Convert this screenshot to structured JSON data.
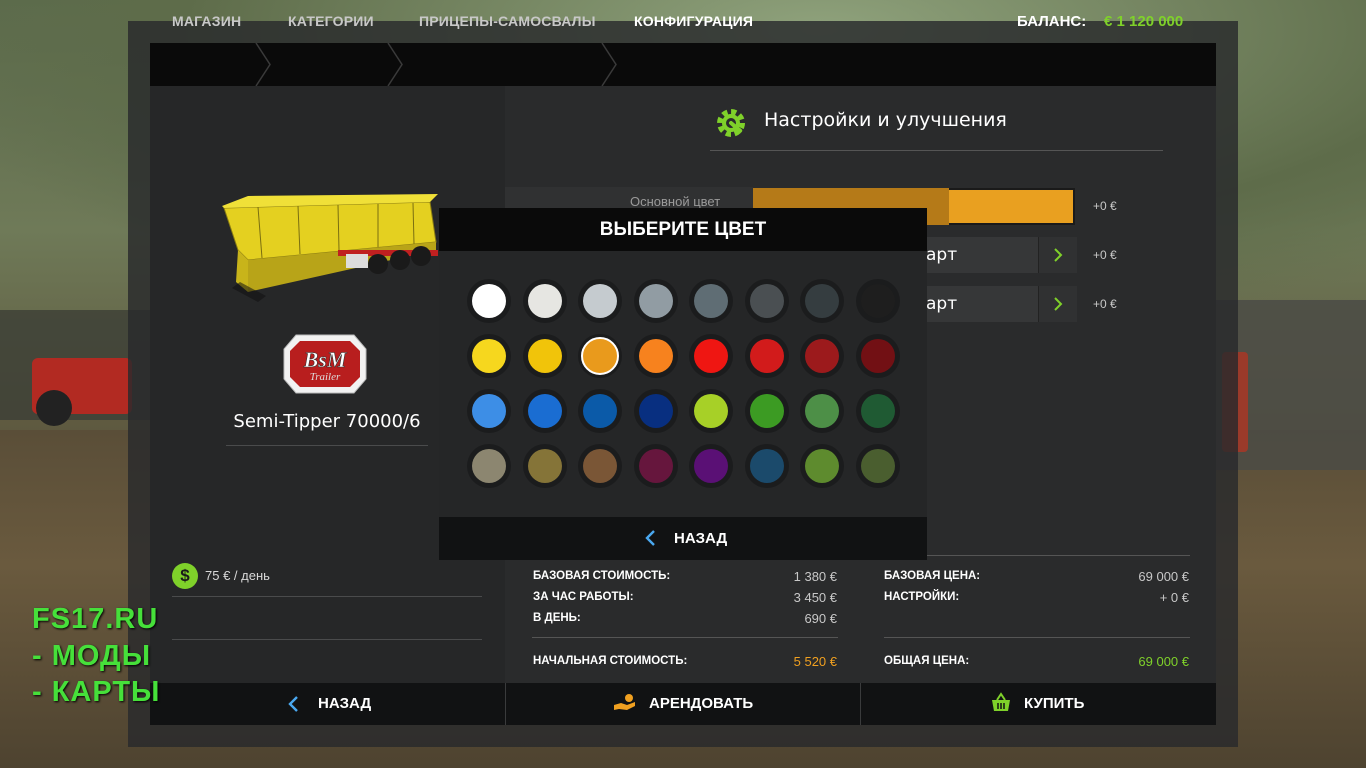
{
  "breadcrumbs": [
    "МАГАЗИН",
    "КАТЕГОРИИ",
    "ПРИЦЕПЫ-САМОСВАЛЫ",
    "КОНФИГУРАЦИЯ"
  ],
  "balance": {
    "label": "БАЛАНС:",
    "value": "€ 1 120 000"
  },
  "item": {
    "name": "Semi-Tipper 70000/6",
    "brand": "BsM Trailer",
    "rent_per_day": "75 € / день"
  },
  "settings": {
    "title": "Настройки и улучшения",
    "rows": [
      {
        "label": "Основной цвет",
        "price": "+0 €",
        "color": "#e9a020"
      },
      {
        "value": "арт",
        "price": "+0 €"
      },
      {
        "value": "арт",
        "price": "+0 €"
      }
    ]
  },
  "stats_left": {
    "base_cost_label": "БАЗОВАЯ СТОИМОСТЬ:",
    "base_cost": "1 380 €",
    "per_hour_label": "ЗА ЧАС РАБОТЫ:",
    "per_hour": "3 450 €",
    "per_day_label": "В ДЕНЬ:",
    "per_day": "690 €",
    "initial_cost_label": "НАЧАЛЬНАЯ СТОИМОСТЬ:",
    "initial_cost": "5 520 €"
  },
  "stats_right": {
    "base_price_label": "БАЗОВАЯ ЦЕНА:",
    "base_price": "69 000 €",
    "settings_label": "НАСТРОЙКИ:",
    "settings_price": "+ 0 €",
    "total_label": "ОБЩАЯ ЦЕНА:",
    "total": "69 000 €"
  },
  "bottom": {
    "back": "НАЗАД",
    "rent": "АРЕНДОВАТЬ",
    "buy": "КУПИТЬ"
  },
  "modal": {
    "title": "ВЫБЕРИТЕ ЦВЕТ",
    "back": "НАЗАД",
    "selected_index": 10,
    "colors": [
      "#ffffff",
      "#e6e6e2",
      "#c5cbcf",
      "#919ca3",
      "#5f6d74",
      "#4a4f52",
      "#353d40",
      "#1e1e1e",
      "#f6d71e",
      "#f1c40a",
      "#e99a1c",
      "#f7821e",
      "#ef1612",
      "#d21b1b",
      "#9c1a1c",
      "#721014",
      "#3d8ee6",
      "#1a6dd2",
      "#0b5aa8",
      "#082f80",
      "#a7d027",
      "#3c9b23",
      "#4d8f47",
      "#1f5a33",
      "#8c8670",
      "#857438",
      "#7a5636",
      "#66163d",
      "#5a1075",
      "#1b4a6b",
      "#5e8b2e",
      "#4a5e2f"
    ]
  },
  "watermark": [
    "FS17.RU",
    "- МОДЫ",
    "- КАРТЫ"
  ],
  "accent_color": "#7fd12a"
}
